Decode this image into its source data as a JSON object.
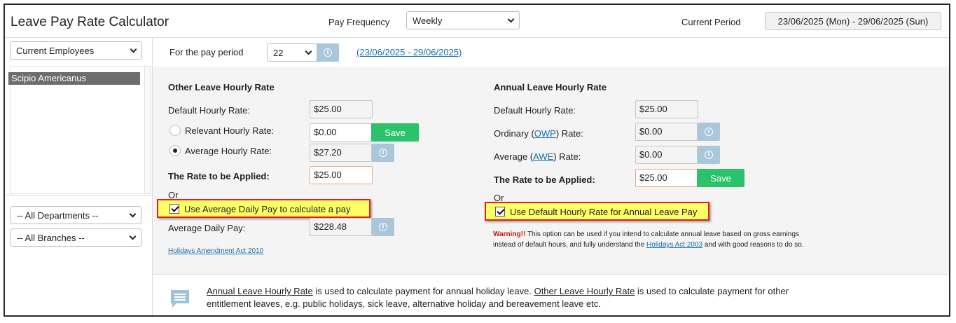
{
  "header": {
    "title": "Leave Pay Rate Calculator",
    "pay_frequency_label": "Pay Frequency",
    "pay_frequency_value": "Weekly",
    "current_period_label": "Current Period",
    "current_period_value": "23/06/2025 (Mon) - 29/06/2025 (Sun)"
  },
  "sidebar": {
    "employee_filter": "Current Employees",
    "employees": [
      "Scipio Americanus"
    ],
    "department_filter": "-- All Departments --",
    "branch_filter": "-- All Branches --"
  },
  "period_bar": {
    "label": "For the pay period",
    "period_number": "22",
    "period_range": "(23/06/2025 - 29/06/2025)"
  },
  "other_leave": {
    "title": "Other Leave Hourly Rate",
    "default_label": "Default Hourly Rate:",
    "default_value": "$25.00",
    "relevant_label": "Relevant Hourly Rate:",
    "relevant_value": "$0.00",
    "save_label": "Save",
    "average_label": "Average Hourly Rate:",
    "average_value": "$27.20",
    "applied_label": "The Rate to be Applied:",
    "applied_value": "$25.00",
    "or_label": "Or",
    "checkbox_label": "Use Average Daily Pay to calculate a pay",
    "daily_label": "Average Daily Pay:",
    "daily_value": "$228.48",
    "act_link": "Holidays Amendment Act 2010"
  },
  "annual_leave": {
    "title": "Annual Leave Hourly Rate",
    "default_label": "Default Hourly Rate:",
    "default_value": "$25.00",
    "ordinary_prefix": "Ordinary (",
    "ordinary_link": "OWP",
    "ordinary_suffix": ") Rate:",
    "ordinary_value": "$0.00",
    "average_prefix": "Average (",
    "average_link": "AWE",
    "average_suffix": ") Rate:",
    "average_value": "$0.00",
    "applied_label": "The Rate to be Applied:",
    "applied_value": "$25.00",
    "save_label": "Save",
    "or_label": "Or",
    "checkbox_label": "Use Default Hourly Rate for Annual Leave Pay",
    "warning_title": "Warning!!",
    "warning_text_1": " This option can be used if you intend to calculate annual leave based on gross earnings instead of default hours, and fully understand the ",
    "warning_link": "Holidays Act 2003",
    "warning_text_2": " and with good reasons to do so."
  },
  "note": {
    "annual_link": "Annual Leave Hourly Rate",
    "text_1": " is used to calculate payment for annual holiday leave. ",
    "other_link": "Other Leave Hourly Rate",
    "text_2": " is used to calculate payment for other entitlement leaves, e.g. public holidays, sick leave, alternative holiday and bereavement leave etc."
  },
  "colors": {
    "save_green": "#2ac26a",
    "info_blue": "#a9c6da",
    "highlight_yellow": "#ffff66",
    "highlight_border": "#e02020",
    "warning_red": "#d01414"
  }
}
